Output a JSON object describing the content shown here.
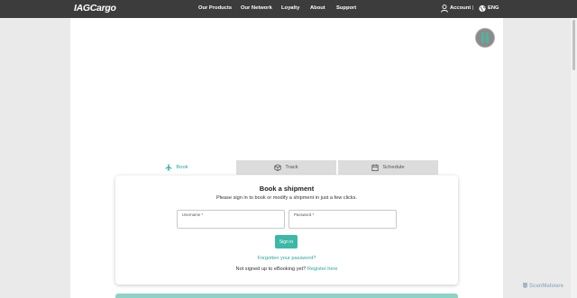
{
  "header": {
    "logo": "IAGCargo",
    "nav": [
      "Our Products",
      "Our Network",
      "Loyalty",
      "About",
      "Support"
    ],
    "account_label": "Account",
    "separator": "|",
    "language": "ENG"
  },
  "tabs": [
    {
      "label": "Book",
      "icon": "plane-icon",
      "active": true
    },
    {
      "label": "Track",
      "icon": "box-icon",
      "active": false
    },
    {
      "label": "Schedule",
      "icon": "calendar-icon",
      "active": false
    }
  ],
  "booking": {
    "title": "Book a shipment",
    "subtitle": "Please sign in to book or modify a shipment in just a few clicks.",
    "username_label": "Username *",
    "password_label": "Password *",
    "signin_label": "Sign in",
    "forgot_label": "Forgotten your password?",
    "register_prompt": "Not signed up to eBooking yet?",
    "register_link": "Register here"
  },
  "colors": {
    "accent": "#3cb8a6",
    "header_bg": "#3c3c3c"
  },
  "watermark": "ScanMalware"
}
